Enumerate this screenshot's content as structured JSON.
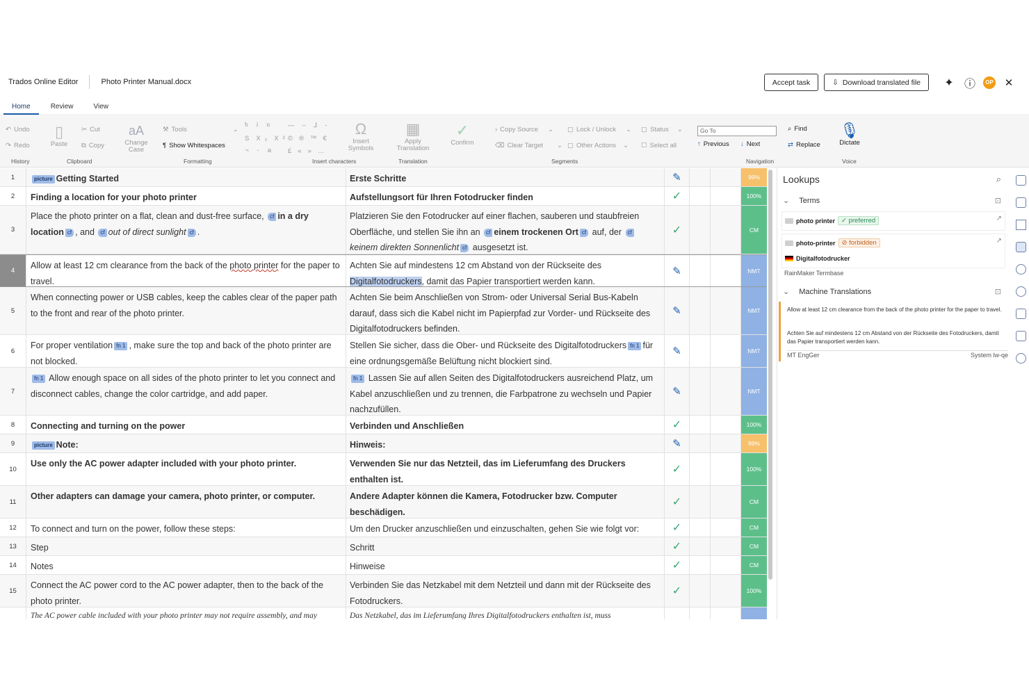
{
  "app": {
    "name": "Trados Online Editor",
    "document": "Photo Printer Manual.docx",
    "accept_task": "Accept task",
    "download": "Download translated file",
    "avatar": "OP"
  },
  "tabs": [
    "Home",
    "Review",
    "View"
  ],
  "ribbon": {
    "history": {
      "undo": "Undo",
      "redo": "Redo",
      "label": "History"
    },
    "clipboard": {
      "paste": "Paste",
      "cut": "Cut",
      "copy": "Copy",
      "label": "Clipboard"
    },
    "formatting": {
      "change_case_1": "Change",
      "change_case_2": "Case",
      "tools": "Tools",
      "show_ws": "Show Whitespaces",
      "label": "Formatting"
    },
    "insert": {
      "symbols_1": "Insert",
      "symbols_2": "Symbols",
      "label": "Insert characters"
    },
    "translation": {
      "apply_1": "Apply",
      "apply_2": "Translation",
      "label": "Translation"
    },
    "segments": {
      "confirm": "Confirm",
      "copy_source": "Copy Source",
      "clear_target": "Clear Target",
      "lock": "Lock / Unlock",
      "other": "Other Actions",
      "status": "Status",
      "select_all": "Select all",
      "label": "Segments"
    },
    "navigation": {
      "goto": "Go To",
      "previous": "Previous",
      "next": "Next",
      "label": "Navigation"
    },
    "find": {
      "find": "Find",
      "replace": "Replace"
    },
    "voice": {
      "dictate": "Dictate",
      "label": "Voice"
    }
  },
  "segments": [
    {
      "n": "1",
      "status": "edit",
      "match": "99%",
      "mcolor": "orange"
    },
    {
      "n": "2",
      "status": "check",
      "match": "100%",
      "mcolor": "green"
    },
    {
      "n": "3",
      "status": "check",
      "match": "CM",
      "mcolor": "green"
    },
    {
      "n": "4",
      "status": "edit",
      "match": "NMT",
      "mcolor": "blue"
    },
    {
      "n": "5",
      "status": "edit",
      "match": "NMT",
      "mcolor": "blue"
    },
    {
      "n": "6",
      "status": "edit",
      "match": "NMT",
      "mcolor": "blue"
    },
    {
      "n": "7",
      "status": "edit",
      "match": "NMT",
      "mcolor": "blue"
    },
    {
      "n": "8",
      "status": "check",
      "match": "100%",
      "mcolor": "green"
    },
    {
      "n": "9",
      "status": "edit",
      "match": "99%",
      "mcolor": "orange"
    },
    {
      "n": "10",
      "status": "check",
      "match": "100%",
      "mcolor": "green"
    },
    {
      "n": "11",
      "status": "check",
      "match": "CM",
      "mcolor": "green"
    },
    {
      "n": "12",
      "status": "check",
      "match": "CM",
      "mcolor": "green"
    },
    {
      "n": "13",
      "status": "check",
      "match": "CM",
      "mcolor": "green"
    },
    {
      "n": "14",
      "status": "check",
      "match": "CM",
      "mcolor": "green"
    },
    {
      "n": "15",
      "status": "check",
      "match": "100%",
      "mcolor": "green"
    },
    {
      "n": "",
      "status": "",
      "match": "",
      "mcolor": "blue"
    }
  ],
  "text": {
    "s1": "Getting Started",
    "t1": "Erste Schritte",
    "s2": "Finding a location for your photo printer",
    "t2": "Aufstellungsort für Ihren Fotodrucker finden",
    "s3a": "Place the photo printer on a flat, clean and dust-free surface, ",
    "s3b": "in a dry location",
    "s3c": ", and ",
    "s3d": "out of direct sunlight",
    "s3e": ".",
    "t3a": "Platzieren Sie den Fotodrucker auf einer flachen, sauberen und staubfreien Oberfläche, und stellen Sie ihn an ",
    "t3b": "einem trockenen Ort",
    "t3c": " auf, der ",
    "t3d": "keinem direkten Sonnenlicht",
    "t3e": " ausgesetzt ist.",
    "s4a": "Allow at least 12 cm clearance from the back of the ",
    "s4b": "photo printer",
    "s4c": " for the paper to travel.",
    "t4a": "Achten Sie auf mindestens 12 cm Abstand von der Rückseite des ",
    "t4b": "Digitalfotodruckers",
    "t4c": ", damit das Papier transportiert werden kann.",
    "s5": "When connecting power or USB cables, keep the cables clear of the paper path to the front and rear of the photo printer.",
    "t5": "Achten Sie beim Anschließen von Strom- oder Universal Serial Bus-Kabeln darauf, dass sich die Kabel nicht im Papierpfad zur Vorder- und Rückseite des Digitalfotodruckers befinden.",
    "s6a": "For proper ventilation",
    "s6b": ", make sure the top and back of the photo printer are not blocked.",
    "t6a": "Stellen Sie sicher, dass die Ober- und Rückseite des Digitalfotodruckers",
    "t6b": "für eine ordnungsgemäße Belüftung nicht blockiert sind.",
    "s7": " Allow enough space on all sides of the photo printer to let you connect and disconnect cables, change the color cartridge, and add paper.",
    "t7": " Lassen Sie auf allen Seiten des Digitalfotodruckers ausreichend Platz, um Kabel anzuschließen und zu trennen, die Farbpatrone zu wechseln und Papier nachzufüllen.",
    "s8": "Connecting and turning on the power",
    "t8": "Verbinden und Anschließen",
    "s9": "Note:",
    "t9": "Hinweis:",
    "s10": "Use only the AC power adapter included with your photo printer.",
    "t10": "Verwenden Sie nur das Netzteil, das im Lieferumfang des Druckers enthalten ist.",
    "s11": "Other adapters can damage your camera, photo printer, or computer.",
    "t11": "Andere Adapter können die Kamera, Fotodrucker bzw. Computer beschädigen.",
    "s12": "To connect and turn on the power, follow these steps:",
    "t12": "Um den Drucker anzuschließen und einzuschalten, gehen Sie wie folgt vor:",
    "s13": "Step",
    "t13": "Schritt",
    "s14": "Notes",
    "t14": "Hinweise",
    "s15": "Connect the AC power cord to the AC power adapter, then to the back of the photo printer.",
    "t15": "Verbinden Sie das Netzkabel mit dem Netzteil und dann mit der Rückseite des Fotodruckers.",
    "s16": "The AC power cable included with your photo printer may not require assembly, and may",
    "t16": "Das Netzkabel, das im Lieferumfang Ihres Digitalfotodruckers enthalten ist, muss",
    "tag_picture": "picture",
    "tag_cf": "cf",
    "tag_fn": "fn 1"
  },
  "lookups": {
    "title": "Lookups",
    "terms_label": "Terms",
    "term1": "photo printer",
    "term1_status": "preferred",
    "term2": "photo-printer",
    "term2_status": "forbidden",
    "term2_target": "Digitalfotodrucker",
    "termbase": "RainMaker Termbase",
    "mt_label": "Machine Translations",
    "mt_source": "Allow at least 12 cm clearance from the back of the photo printer for the paper to travel.",
    "mt_target": "Achten Sie auf mindestens 12 cm Abstand von der Rückseite des Fotodruckers, damit das Papier transportiert werden kann.",
    "mt_engine": "MT EngGer",
    "mt_system": "System lw-qe"
  }
}
